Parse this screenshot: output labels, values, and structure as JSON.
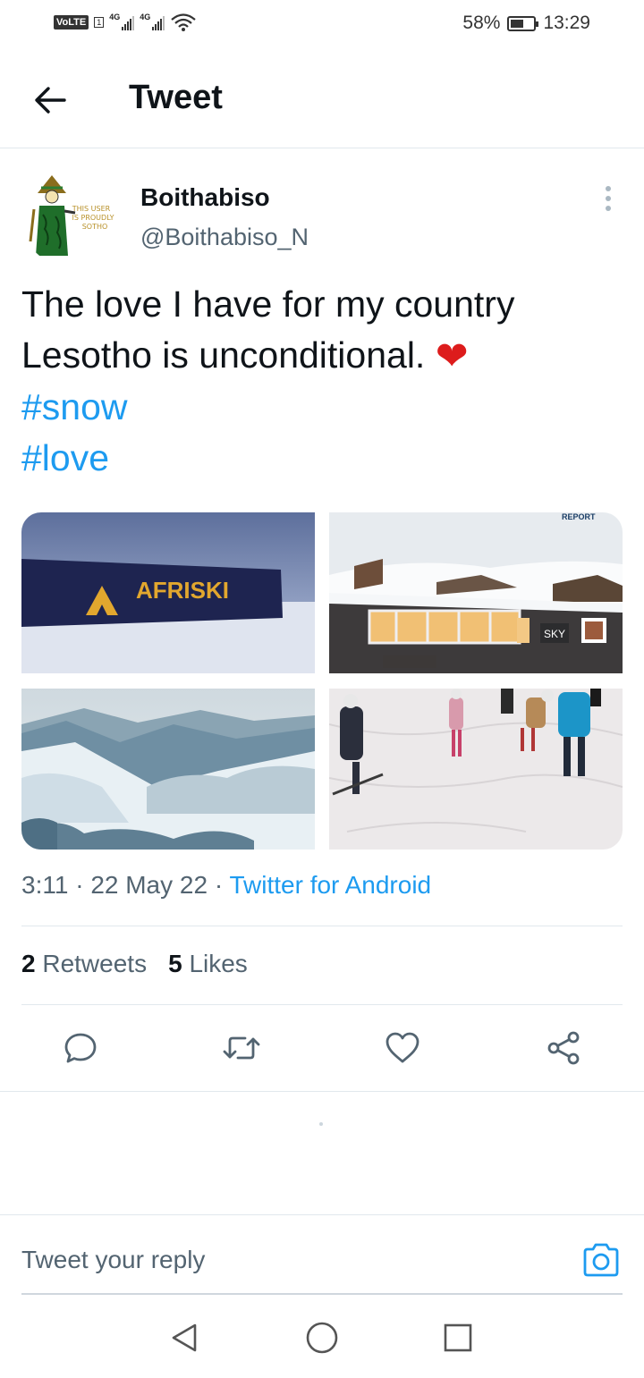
{
  "status_bar": {
    "volte": "VoLTE",
    "sim": "1",
    "network1": "4G",
    "network2": "4G",
    "battery_percent": "58%",
    "battery_level": 0.58,
    "time": "13:29"
  },
  "header": {
    "title": "Tweet",
    "back_icon": "arrow-left-icon"
  },
  "tweet": {
    "author_name": "Boithabiso",
    "author_handle": "@Boithabiso_N",
    "avatar_text": [
      "THIS USER",
      "IS PROUDLY",
      "SOTHO"
    ],
    "text_line1": "The love I have for my country",
    "text_line2": "Lesotho is unconditional.",
    "emoji": "❤",
    "hashtags": [
      "#snow",
      "#love"
    ],
    "media": [
      {
        "sign_text": "AFRISKI"
      },
      {
        "sign_text": "SKY",
        "watermark": "REPORT"
      },
      {},
      {}
    ],
    "time": "3:11",
    "date": "22 May 22",
    "separator": "·",
    "source": "Twitter for Android",
    "retweets_count": "2",
    "retweets_label": "Retweets",
    "likes_count": "5",
    "likes_label": "Likes"
  },
  "actions": [
    "reply-icon",
    "retweet-icon",
    "like-icon",
    "share-icon"
  ],
  "reply": {
    "placeholder": "Tweet your reply",
    "camera_icon": "camera-icon"
  },
  "nav": [
    "back-triangle-icon",
    "home-circle-icon",
    "recents-square-icon"
  ],
  "colors": {
    "accent": "#1d9bf0",
    "text": "#0f1419",
    "secondary": "#536471",
    "heart": "#dd1c1c"
  }
}
